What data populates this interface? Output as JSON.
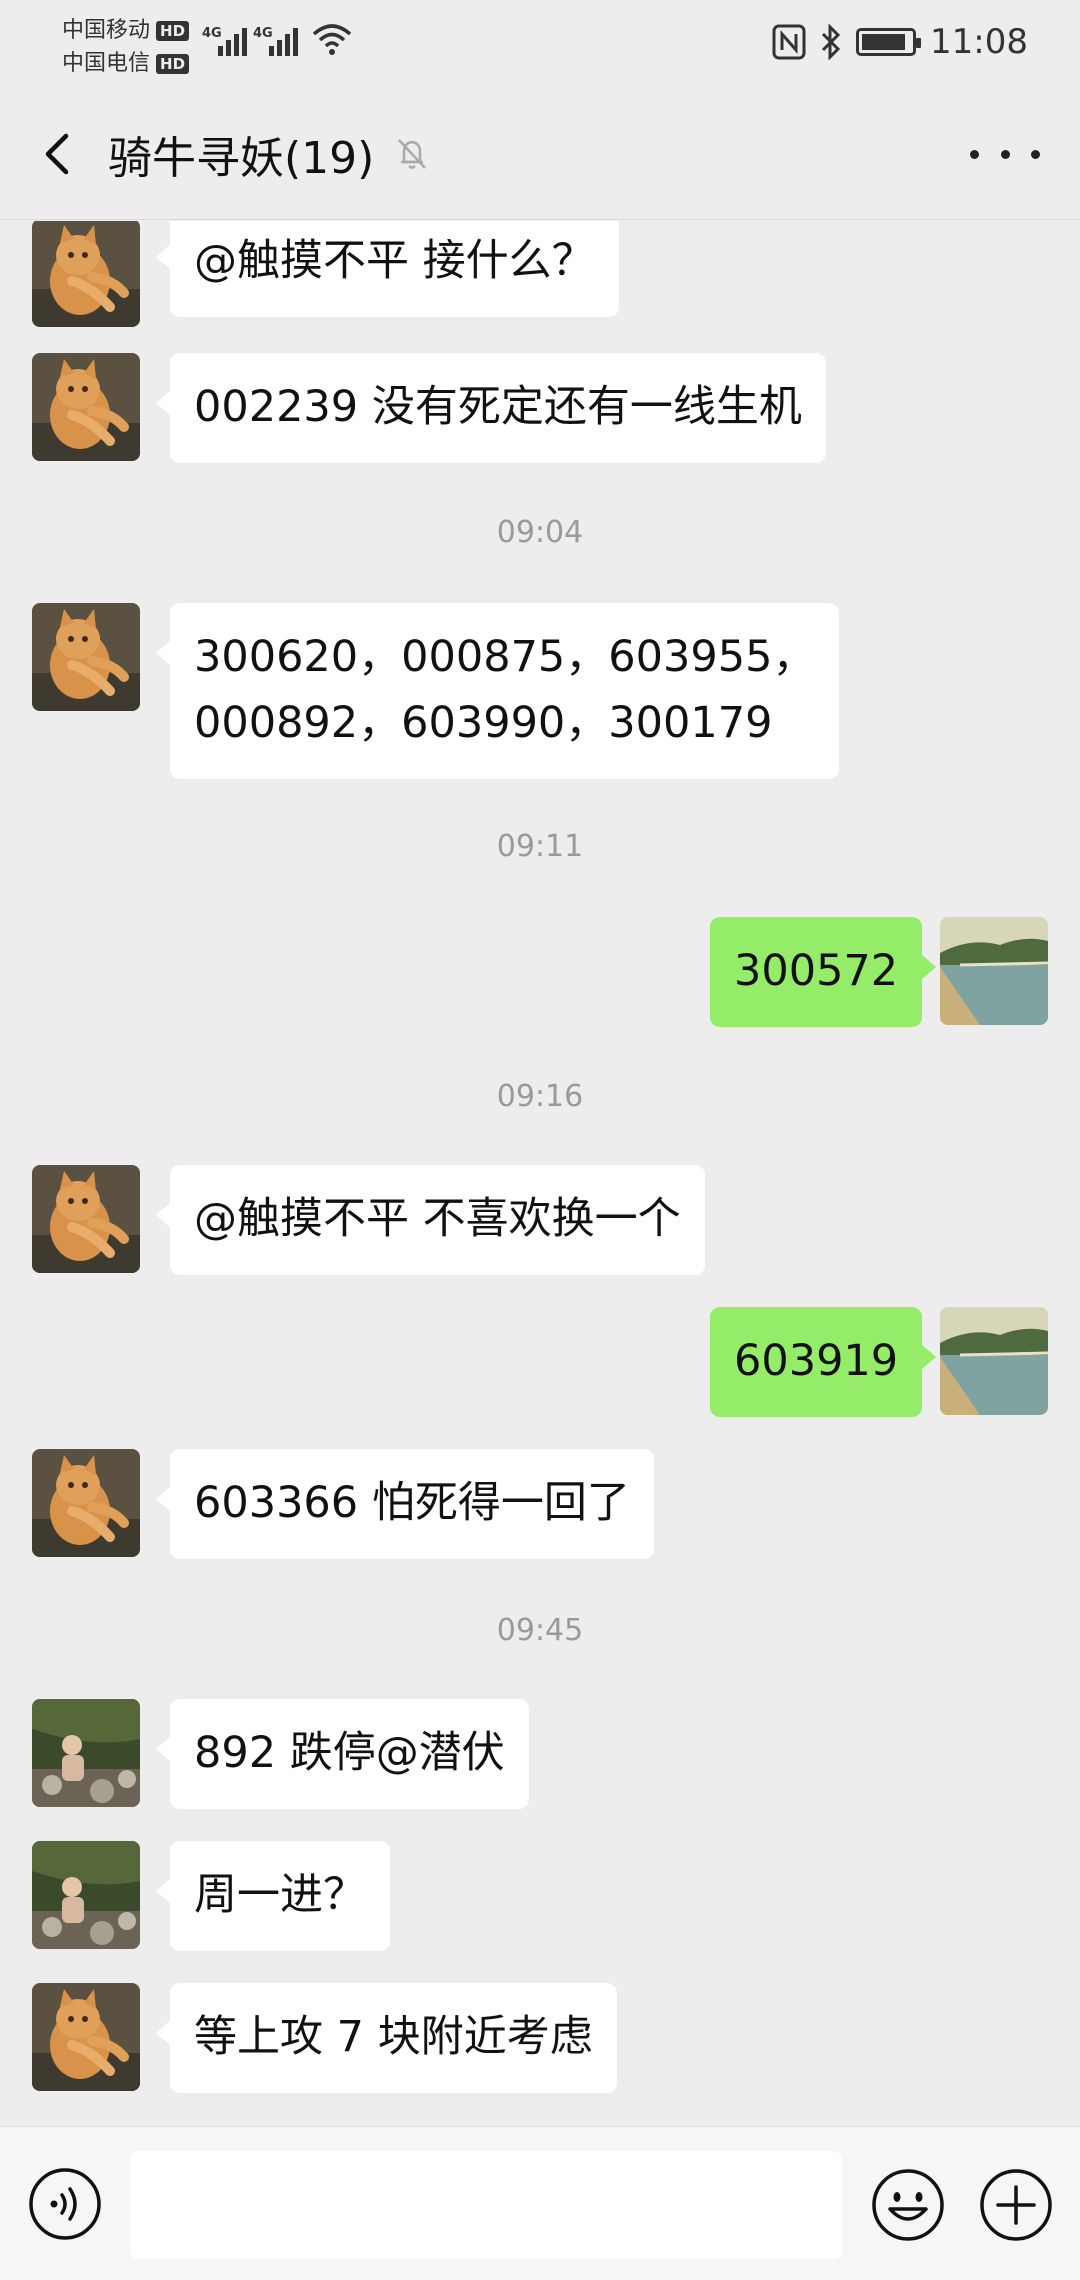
{
  "status_bar": {
    "carrier1": "中国移动",
    "carrier2": "中国电信",
    "hd_badge": "HD",
    "network": "4G",
    "time": "11:08",
    "battery_level": 0.9
  },
  "header": {
    "title": "骑牛寻妖(19)"
  },
  "messages": [
    {
      "side": "in",
      "avatar": "cat-avatar",
      "text": "@触摸不平  接什么？"
    },
    {
      "side": "in",
      "avatar": "cat-avatar",
      "text": "002239 没有死定还有一线生机"
    },
    {
      "timestamp": "09:04"
    },
    {
      "side": "in",
      "avatar": "cat-avatar",
      "line1": "300620，000875，603955，",
      "line2": "000892，603990，300179"
    },
    {
      "timestamp": "09:11"
    },
    {
      "side": "out",
      "avatar": "lake-avatar",
      "text": "300572"
    },
    {
      "timestamp": "09:16"
    },
    {
      "side": "in",
      "avatar": "cat-avatar",
      "text": "@触摸不平  不喜欢换一个"
    },
    {
      "side": "out",
      "avatar": "lake-avatar",
      "text": "603919"
    },
    {
      "side": "in",
      "avatar": "cat-avatar",
      "text": "603366 怕死得一回了"
    },
    {
      "timestamp": "09:45"
    },
    {
      "side": "in",
      "avatar": "child-avatar",
      "text": "892 跌停@潜伏"
    },
    {
      "side": "in",
      "avatar": "child-avatar",
      "text": "周一进？"
    },
    {
      "side": "in",
      "avatar": "cat-avatar",
      "text": "等上攻 7 块附近考虑"
    }
  ],
  "input_bar": {
    "placeholder": "",
    "value": ""
  },
  "colors": {
    "background": "#ededed",
    "incoming_bubble": "#ffffff",
    "outgoing_bubble": "#95ec69",
    "timestamp_text": "#9a9a9a"
  }
}
